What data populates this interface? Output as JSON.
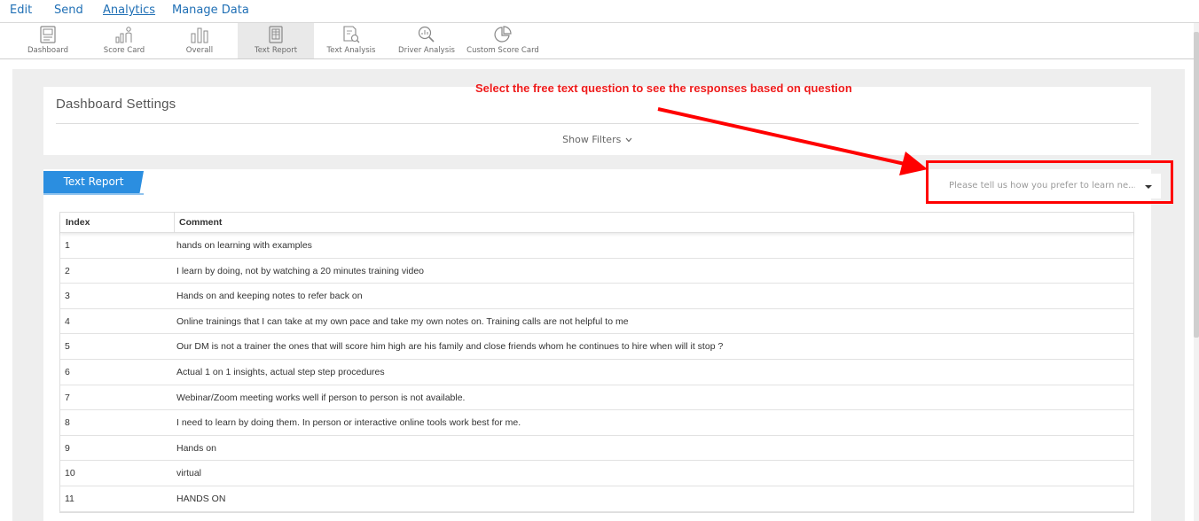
{
  "menu": [
    {
      "label": "Edit",
      "active": false
    },
    {
      "label": "Send",
      "active": false
    },
    {
      "label": "Analytics",
      "active": true
    },
    {
      "label": "Manage Data",
      "active": false
    }
  ],
  "toolbar": [
    {
      "label": "Dashboard",
      "icon": "dashboard-icon",
      "active": false
    },
    {
      "label": "Score Card",
      "icon": "score-card-icon",
      "active": false
    },
    {
      "label": "Overall",
      "icon": "bar-chart-icon",
      "active": false
    },
    {
      "label": "Text Report",
      "icon": "text-report-icon",
      "active": true
    },
    {
      "label": "Text Analysis",
      "icon": "text-analysis-icon",
      "active": false
    },
    {
      "label": "Driver Analysis",
      "icon": "driver-analysis-icon",
      "active": false
    },
    {
      "label": "Custom Score Card",
      "icon": "pie-chart-icon",
      "active": false
    }
  ],
  "settings": {
    "title": "Dashboard Settings",
    "show_filters": "Show Filters"
  },
  "report": {
    "tab_label": "Text Report",
    "question_select": "Please tell us how you prefer to learn ne..."
  },
  "annotation": {
    "text": "Select the free text question to see the responses based on question",
    "color": "#ee1b1b"
  },
  "table": {
    "headers": {
      "index": "Index",
      "comment": "Comment"
    },
    "rows": [
      {
        "index": "1",
        "comment": "hands on learning with examples"
      },
      {
        "index": "2",
        "comment": "I learn by doing, not by watching a 20 minutes training video"
      },
      {
        "index": "3",
        "comment": "Hands on and keeping notes to refer back on"
      },
      {
        "index": "4",
        "comment": "Online trainings that I can take at my own pace and take my own notes on. Training calls are not helpful to me"
      },
      {
        "index": "5",
        "comment": "Our DM is not a trainer the ones that will score him high are his family and close friends whom he continues to hire when will it stop ?"
      },
      {
        "index": "6",
        "comment": "Actual 1 on 1 insights, actual step step procedures"
      },
      {
        "index": "7",
        "comment": "Webinar/Zoom meeting works well if person to person is not available."
      },
      {
        "index": "8",
        "comment": "I need to learn by doing them. In person or interactive online tools work best for me."
      },
      {
        "index": "9",
        "comment": "Hands on"
      },
      {
        "index": "10",
        "comment": "virtual"
      },
      {
        "index": "11",
        "comment": "HANDS ON"
      }
    ]
  },
  "colors": {
    "link": "#1f6fb5",
    "tab_blue": "#2b8ee0",
    "highlight": "#ff0000"
  }
}
